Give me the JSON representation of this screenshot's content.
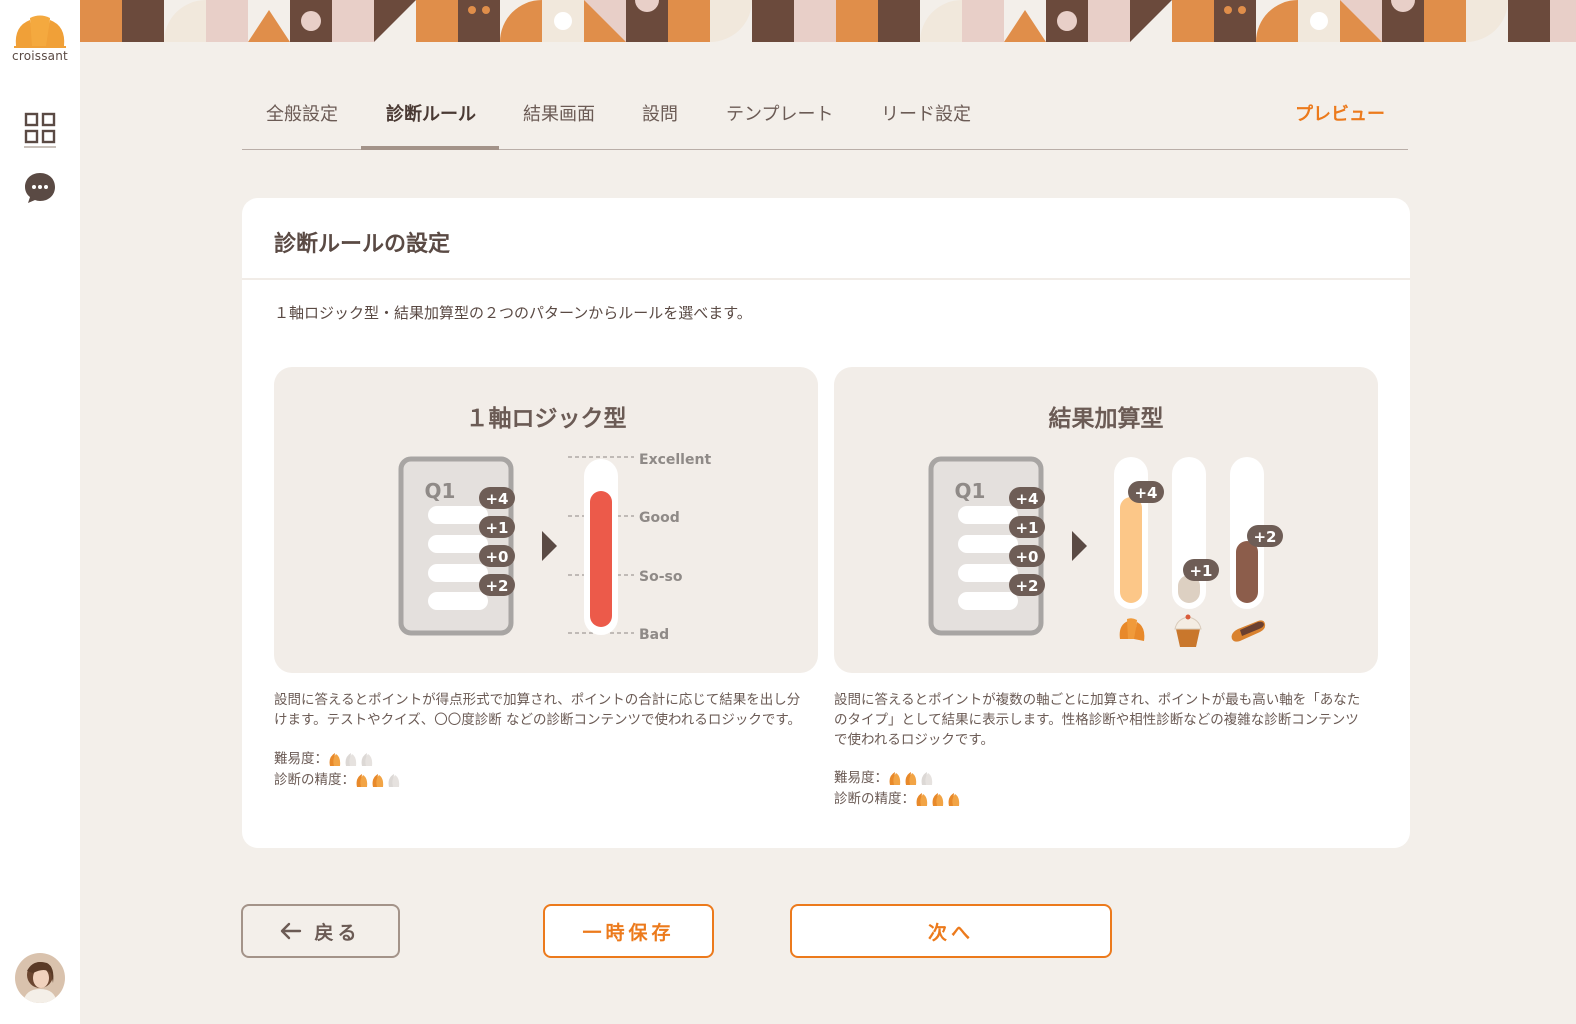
{
  "app": {
    "logo_text": "croissant"
  },
  "sidebar": {
    "items": [
      {
        "icon": "grid-icon"
      },
      {
        "icon": "chat-bubble-icon"
      }
    ]
  },
  "tabs": [
    {
      "label": "全般設定"
    },
    {
      "label": "診断ルール",
      "active": true
    },
    {
      "label": "結果画面"
    },
    {
      "label": "設問"
    },
    {
      "label": "テンプレート"
    },
    {
      "label": "リード設定"
    }
  ],
  "preview_label": "プレビュー",
  "card": {
    "title": "診断ルールの設定",
    "description": "１軸ロジック型・結果加算型の２つのパターンからルールを選べます。",
    "options": [
      {
        "title": "１軸ロジック型",
        "question_label": "Q1",
        "points": [
          "+4",
          "+1",
          "+0",
          "+2"
        ],
        "scale_labels": [
          "Excellent",
          "Good",
          "So-so",
          "Bad"
        ],
        "description_lines": [
          "設問に答えるとポイントが得点形式で加算され、ポイントの合計に応じて結果を出し分",
          "けます。テストやクイズ、〇〇度診断 などの診断コンテンツで使われるロジックです。"
        ],
        "difficulty_label": "難易度：",
        "difficulty": 1,
        "accuracy_label": "診断の精度：",
        "accuracy": 2,
        "max_rating": 3
      },
      {
        "title": "結果加算型",
        "question_label": "Q1",
        "points": [
          "+4",
          "+1",
          "+0",
          "+2"
        ],
        "axis_points": [
          "+4",
          "+1",
          "+2"
        ],
        "axis_levels": [
          0.76,
          0.2,
          0.44
        ],
        "axis_colors": [
          "#fcc788",
          "#ddd0c2",
          "#8c5d4b"
        ],
        "axis_icons": [
          "croissant-icon",
          "cupcake-icon",
          "eclair-icon"
        ],
        "description_lines": [
          "設問に答えるとポイントが複数の軸ごとに加算され、ポイントが最も高い軸を「あなた",
          "のタイプ」として結果に表示します。性格診断や相性診断などの複雑な診断コンテンツ",
          "で使われるロジックです。"
        ],
        "difficulty_label": "難易度：",
        "difficulty": 2,
        "accuracy_label": "診断の精度：",
        "accuracy": 3,
        "max_rating": 3
      }
    ]
  },
  "buttons": {
    "back": "戻る",
    "save": "一時保存",
    "next": "次へ"
  },
  "colors": {
    "accent": "#ec7a1c",
    "gauge_fill": "#ec5a4a",
    "background": "#f3efea"
  }
}
